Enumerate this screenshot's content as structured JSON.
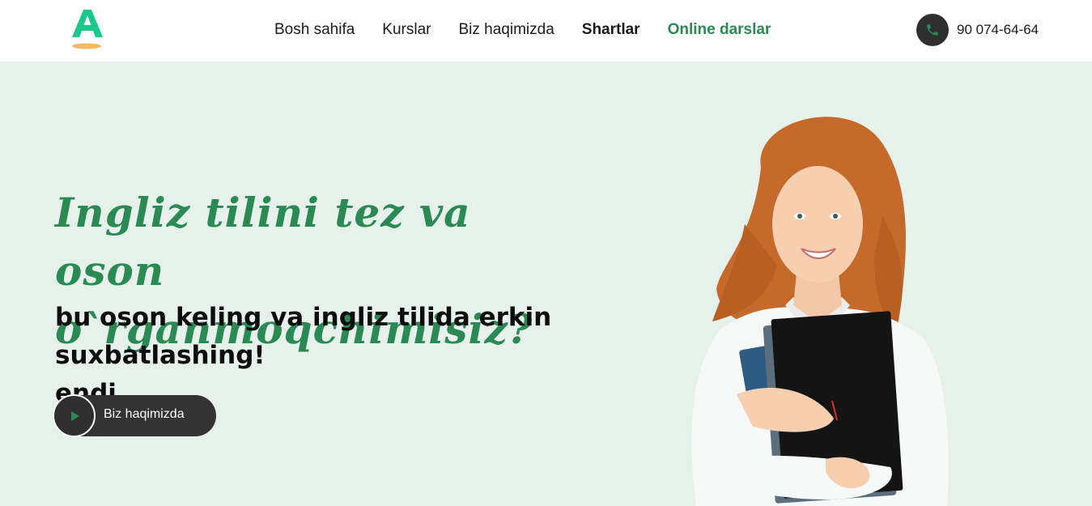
{
  "header": {
    "logo_letter": "A",
    "nav": [
      {
        "label": "Bosh sahifa",
        "style": "normal"
      },
      {
        "label": "Kurslar",
        "style": "normal"
      },
      {
        "label": "Biz haqimizda",
        "style": "normal"
      },
      {
        "label": "Shartlar",
        "style": "bold"
      },
      {
        "label": "Online darslar",
        "style": "active"
      }
    ],
    "phone": {
      "icon": "phone-icon",
      "number": "90 074-64-64"
    }
  },
  "hero": {
    "headline_green_1": "Ingliz tilini tez va oson",
    "headline_green_2": "o`rganmoqchimisiz?",
    "headline_dark_inline": "endi",
    "subline_1": "bu oson keling va ingliz tilida erkin",
    "subline_2": "suxbatlashing!",
    "cta": {
      "icon": "play-icon",
      "label": "Biz haqimizda"
    },
    "image": "student-girl-holding-folders"
  },
  "colors": {
    "accent": "#2b8a53",
    "hero_bg": "#e6f1eb",
    "dark": "#333333",
    "logo_green": "#19c98a",
    "logo_orange": "#f6b860"
  }
}
